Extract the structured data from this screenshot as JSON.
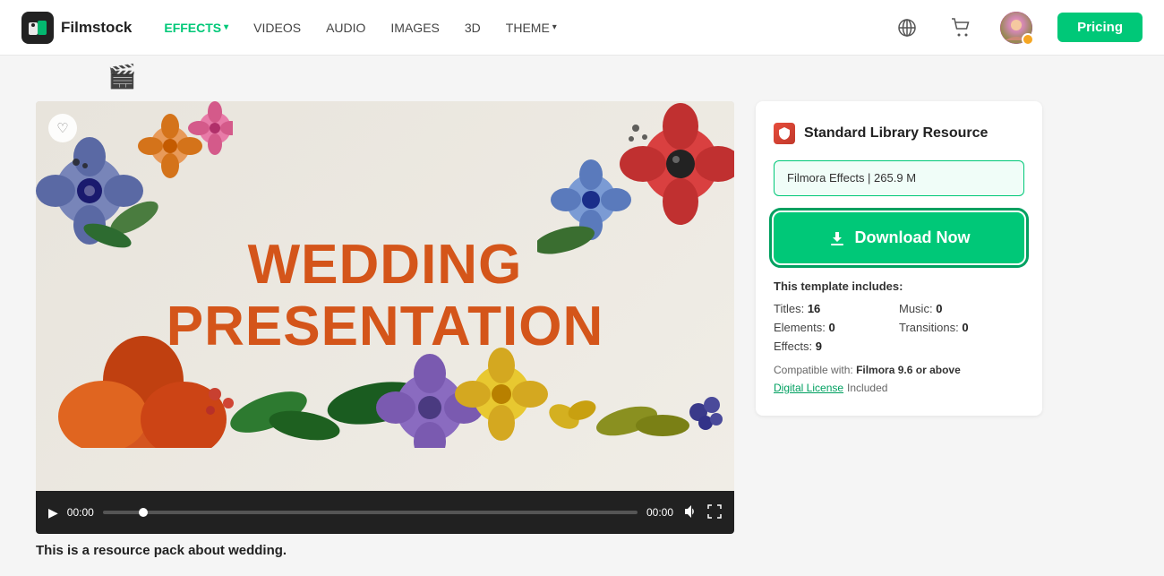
{
  "navbar": {
    "logo_text": "Filmstock",
    "nav_items": [
      {
        "label": "EFFECTS",
        "active": true,
        "has_chevron": true
      },
      {
        "label": "VIDEOS",
        "active": false,
        "has_chevron": false
      },
      {
        "label": "AUDIO",
        "active": false,
        "has_chevron": false
      },
      {
        "label": "IMAGES",
        "active": false,
        "has_chevron": false
      },
      {
        "label": "3D",
        "active": false,
        "has_chevron": false
      },
      {
        "label": "THEME",
        "active": false,
        "has_chevron": true
      }
    ],
    "pricing_label": "Pricing"
  },
  "video": {
    "wedding_line1": "WEDDING",
    "wedding_line2": "PRESENTATION",
    "heart_icon": "♡",
    "time_current": "00:00",
    "time_total": "00:00",
    "play_icon": "▶",
    "volume_icon": "🔊",
    "fullscreen_icon": "⛶"
  },
  "panel": {
    "resource_badge": "🛡",
    "resource_title": "Standard Library Resource",
    "file_info": "Filmora Effects | 265.9 M",
    "download_label": "Download Now",
    "includes_title": "This template includes:",
    "titles_label": "Titles:",
    "titles_val": "16",
    "music_label": "Music:",
    "music_val": "0",
    "elements_label": "Elements:",
    "elements_val": "0",
    "transitions_label": "Transitions:",
    "transitions_val": "0",
    "effects_label": "Effects:",
    "effects_val": "9",
    "compatible_label": "Compatible with:",
    "compatible_val": "Filmora 9.6 or above",
    "license_link_text": "Digital License",
    "license_suffix": "Included"
  },
  "bottom": {
    "description": "This is a resource pack about wedding."
  }
}
